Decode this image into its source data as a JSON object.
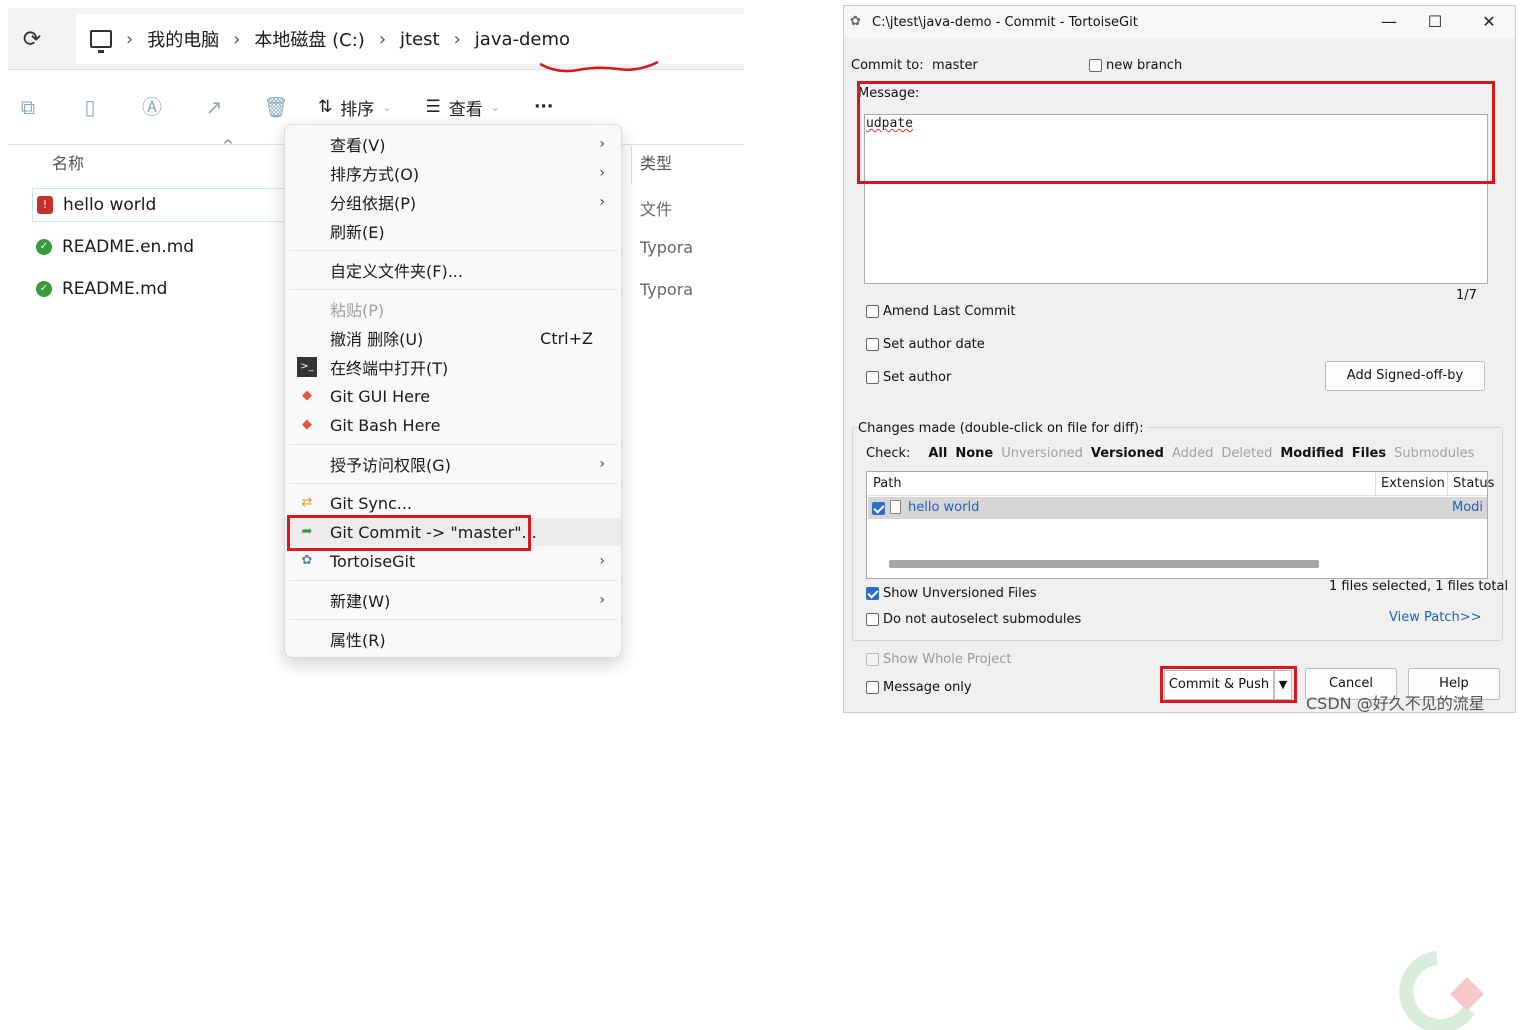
{
  "explorer": {
    "breadcrumb": [
      "我的电脑",
      "本地磁盘 (C:)",
      "jtest",
      "java-demo"
    ],
    "toolbar": {
      "sort_label": "排序",
      "view_label": "查看",
      "more_label": "···"
    },
    "columns": {
      "name": "名称",
      "type": "类型"
    },
    "files": [
      {
        "name": "hello world",
        "type": "文件"
      },
      {
        "name": "README.en.md",
        "type": "Typora"
      },
      {
        "name": "README.md",
        "type": "Typora"
      }
    ]
  },
  "context_menu": {
    "items": [
      {
        "label": "查看(V)",
        "submenu": true
      },
      {
        "label": "排序方式(O)",
        "submenu": true
      },
      {
        "label": "分组依据(P)",
        "submenu": true
      },
      {
        "label": "刷新(E)"
      },
      {
        "label": "自定义文件夹(F)..."
      },
      {
        "label": "粘贴(P)",
        "disabled": true
      },
      {
        "label": "撤消 删除(U)",
        "shortcut": "Ctrl+Z"
      },
      {
        "label": "在终端中打开(T)"
      },
      {
        "label": "Git GUI Here"
      },
      {
        "label": "Git Bash Here"
      },
      {
        "label": "授予访问权限(G)",
        "submenu": true
      },
      {
        "label": "Git Sync..."
      },
      {
        "label": "Git Commit -> \"master\"..."
      },
      {
        "label": "TortoiseGit",
        "submenu": true
      },
      {
        "label": "新建(W)",
        "submenu": true
      },
      {
        "label": "属性(R)"
      }
    ]
  },
  "dialog": {
    "title": "C:\\jtest\\java-demo - Commit - TortoiseGit",
    "commit_to_label": "Commit to:",
    "branch": "master",
    "new_branch_label": "new branch",
    "message_label": "Message:",
    "message_text": "udpate",
    "line_counter": "1/7",
    "amend_label": "Amend Last Commit",
    "set_author_date_label": "Set author date",
    "set_author_label": "Set author",
    "signed_off_button": "Add Signed-off-by",
    "changes_label": "Changes made (double-click on file for diff):",
    "check_label": "Check:",
    "check_filters": [
      {
        "label": "All",
        "enabled": true
      },
      {
        "label": "None",
        "enabled": true
      },
      {
        "label": "Unversioned",
        "enabled": false
      },
      {
        "label": "Versioned",
        "enabled": true
      },
      {
        "label": "Added",
        "enabled": false
      },
      {
        "label": "Deleted",
        "enabled": false
      },
      {
        "label": "Modified",
        "enabled": true
      },
      {
        "label": "Files",
        "enabled": true
      },
      {
        "label": "Submodules",
        "enabled": false
      }
    ],
    "list_columns": {
      "path": "Path",
      "extension": "Extension",
      "status": "Status"
    },
    "list_rows": [
      {
        "path": "hello world",
        "status": "Modi"
      }
    ],
    "show_unversioned_label": "Show Unversioned Files",
    "selection_summary": "1 files selected, 1 files total",
    "no_autoselect_label": "Do not autoselect submodules",
    "view_patch_label": "View Patch>>",
    "show_whole_project_label": "Show Whole Project",
    "message_only_label": "Message only",
    "commit_push_button": "Commit & Push",
    "cancel_button": "Cancel",
    "help_button": "Help"
  },
  "watermark": "CSDN @好久不见的流星",
  "colors": {
    "highlight": "#d9181c",
    "link": "#1f5fbf",
    "check": "#2d6fc8"
  }
}
